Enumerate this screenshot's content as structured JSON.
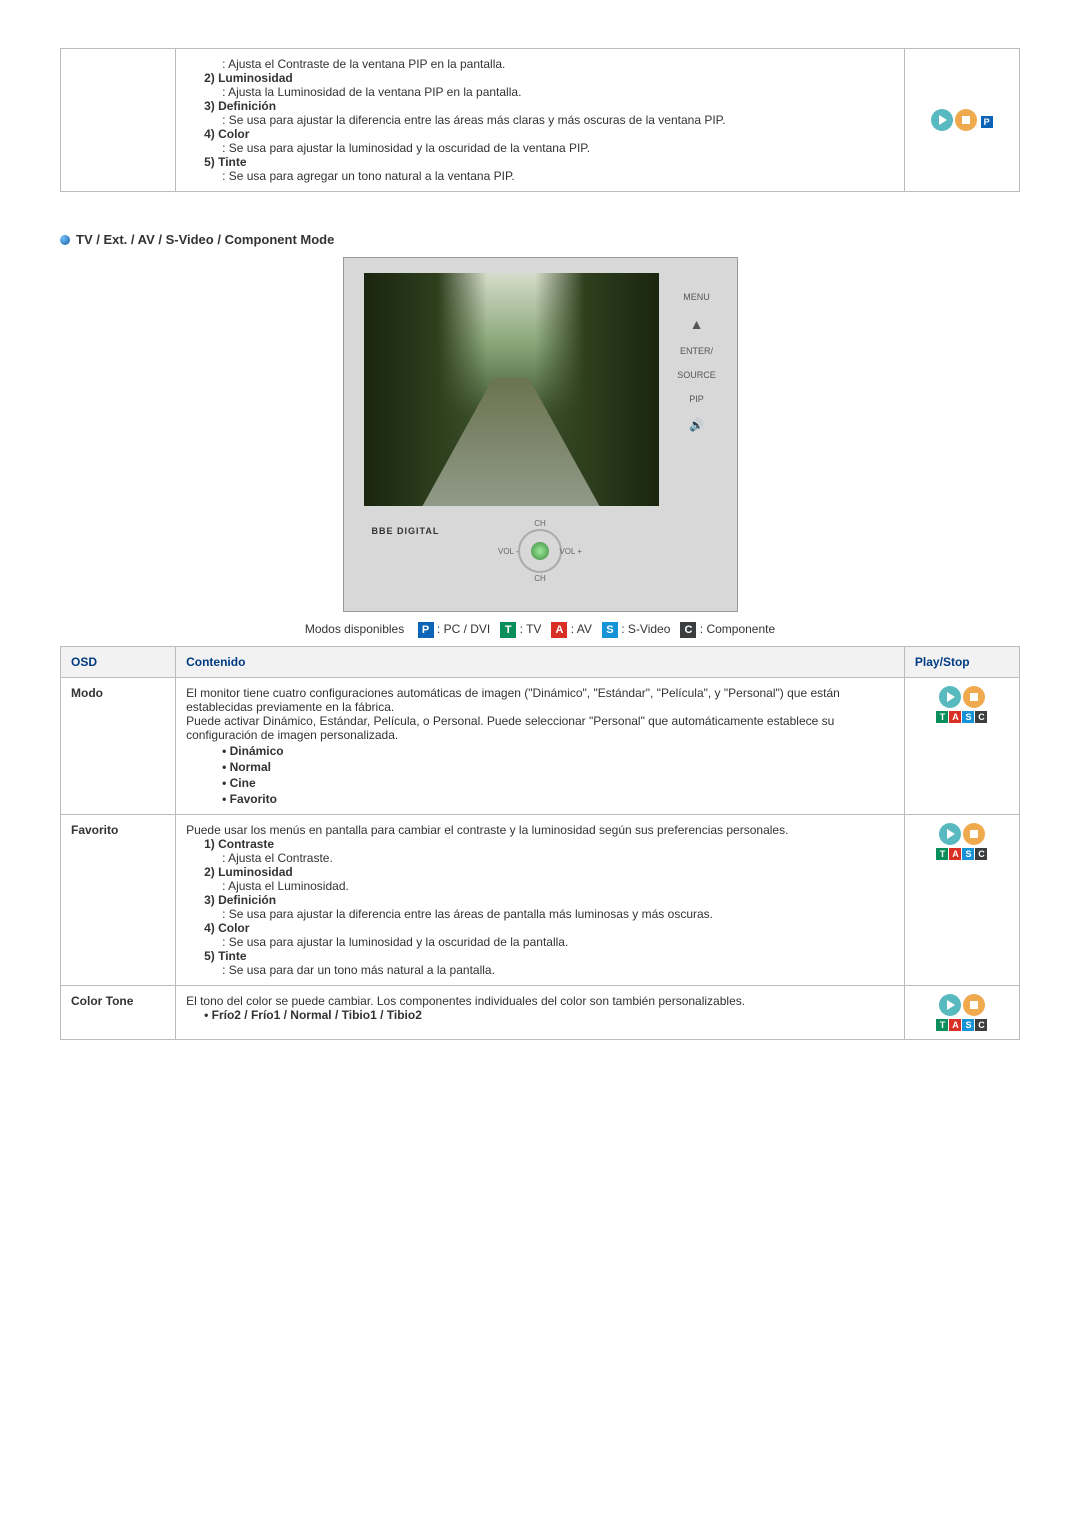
{
  "top_table": {
    "items": [
      {
        "desc": ": Ajusta el Contraste de la ventana PIP en la pantalla."
      },
      {
        "title": "2) Luminosidad",
        "desc": ": Ajusta la Luminosidad de la ventana PIP en la pantalla."
      },
      {
        "title": "3) Definición",
        "desc": ": Se usa para ajustar la diferencia entre las áreas más claras y más oscuras de la ventana PIP."
      },
      {
        "title": "4) Color",
        "desc": ": Se usa para ajustar la luminosidad y la oscuridad de la ventana PIP."
      },
      {
        "title": "5) Tinte",
        "desc": ": Se usa para agregar un tono natural a la ventana PIP."
      }
    ]
  },
  "section_title": "TV / Ext. / AV / S-Video / Component Mode",
  "tv_panel": {
    "menu": "MENU",
    "enter": "ENTER/",
    "source": "SOURCE",
    "pip": "PIP"
  },
  "tv_controls": {
    "ch": "CH",
    "vol_minus": "VOL\n-",
    "vol_plus": "VOL\n+"
  },
  "tv_logo": "BBE  DIGITAL",
  "modes": {
    "label": "Modos disponibles",
    "items": [
      {
        "badge": "P",
        "cls": "mb-p",
        "text": ": PC / DVI"
      },
      {
        "badge": "T",
        "cls": "mb-t",
        "text": ": TV"
      },
      {
        "badge": "A",
        "cls": "mb-a",
        "text": ": AV"
      },
      {
        "badge": "S",
        "cls": "mb-s",
        "text": ": S-Video"
      },
      {
        "badge": "C",
        "cls": "mb-c",
        "text": ": Componente"
      }
    ]
  },
  "table2": {
    "headers": {
      "osd": "OSD",
      "contenido": "Contenido",
      "playstop": "Play/Stop"
    },
    "rows": {
      "modo": {
        "label": "Modo",
        "para": "El monitor tiene cuatro configuraciones automáticas de imagen (\"Dinámico\", \"Estándar\", \"Película\", y \"Personal\") que están establecidas previamente en la fábrica.\nPuede activar Dinámico, Estándar, Película, o Personal. Puede seleccionar \"Personal\" que automáticamente establece su configuración de imagen personalizada.",
        "bullets": [
          "Dinámico",
          "Normal",
          "Cine",
          "Favorito"
        ]
      },
      "favorito": {
        "label": "Favorito",
        "para": "Puede usar los menús en pantalla para cambiar el contraste y la luminosidad según sus preferencias personales.",
        "items": [
          {
            "t": "1) Contraste",
            "d": ": Ajusta el Contraste."
          },
          {
            "t": "2) Luminosidad",
            "d": ": Ajusta el Luminosidad."
          },
          {
            "t": "3) Definición",
            "d": ": Se usa para ajustar la diferencia entre las áreas de pantalla más luminosas y más oscuras."
          },
          {
            "t": "4) Color",
            "d": ": Se usa para ajustar la luminosidad y la oscuridad de la pantalla."
          },
          {
            "t": "5) Tinte",
            "d": ": Se usa para dar un tono más natural a la pantalla."
          }
        ]
      },
      "colortone": {
        "label": "Color Tone",
        "para": "El tono del color se puede cambiar. Los componentes individuales del color son también personalizables.",
        "sub": "• Frío2 / Frío1 / Normal / Tibio1 / Tibio2"
      }
    }
  },
  "badge_letters": {
    "t": "T",
    "a": "A",
    "s": "S",
    "c": "C",
    "p": "P"
  }
}
